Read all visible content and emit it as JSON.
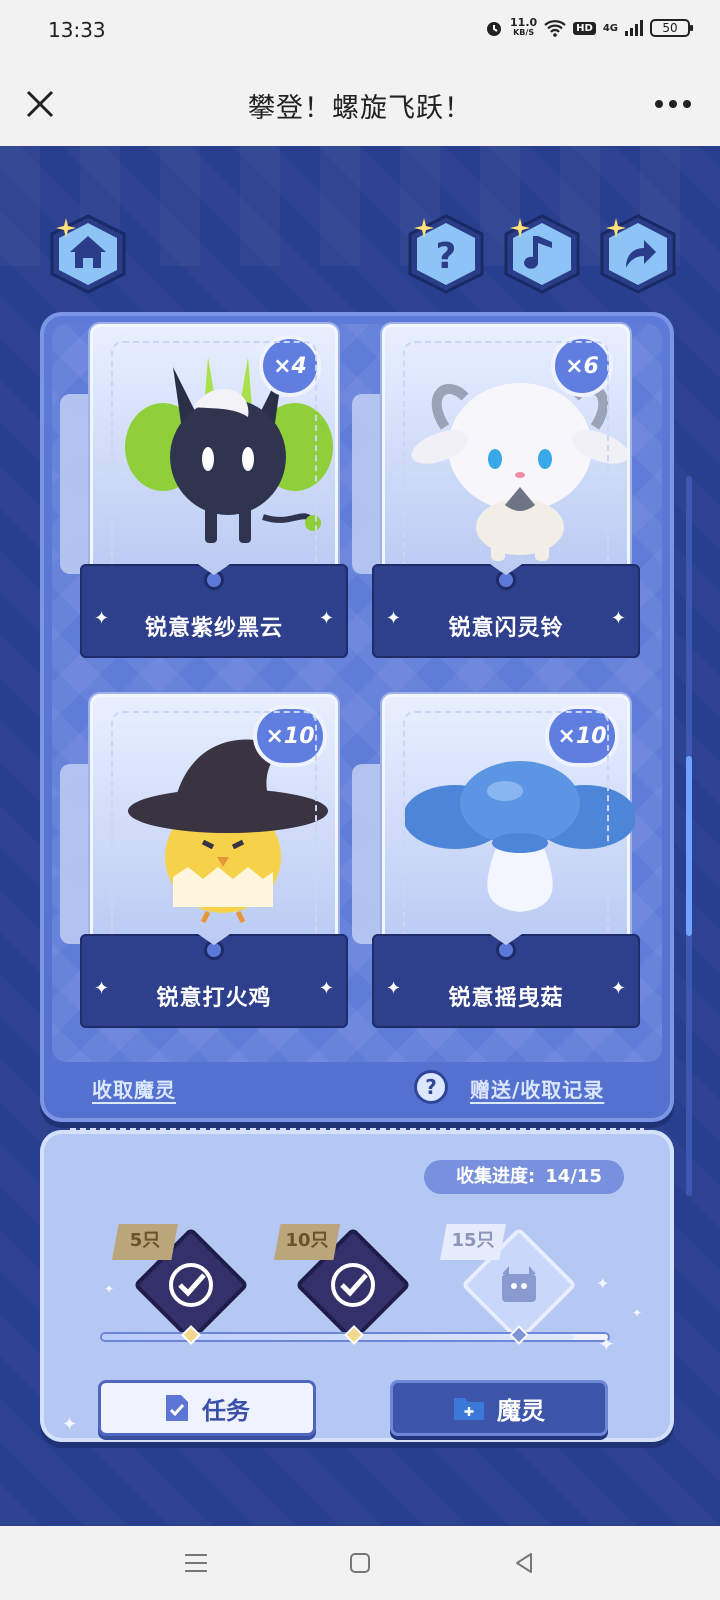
{
  "status_bar": {
    "time": "13:33",
    "net_speed_value": "11.0",
    "net_speed_unit": "KB/S",
    "hd_label": "HD",
    "network": "4G",
    "battery": "50"
  },
  "titlebar": {
    "title": "攀登！螺旋飞跃！"
  },
  "cards": [
    {
      "name": "锐意紫纱黑云",
      "count": "×4"
    },
    {
      "name": "锐意闪灵铃",
      "count": "×6"
    },
    {
      "name": "锐意打火鸡",
      "count": "×10"
    },
    {
      "name": "锐意摇曳菇",
      "count": "×10"
    }
  ],
  "links": {
    "collect": "收取魔灵",
    "history": "赠送/收取记录",
    "help_symbol": "?"
  },
  "progress": {
    "label": "收集进度:",
    "value": "14/15",
    "fraction": 0.9333,
    "milestones": [
      {
        "label": "5只",
        "done": true
      },
      {
        "label": "10只",
        "done": true
      },
      {
        "label": "15只",
        "done": false
      }
    ]
  },
  "buttons": {
    "task": "任务",
    "spirit": "魔灵"
  },
  "colors": {
    "game_bg": "#283e8e",
    "panel": "#5d7ad8",
    "plate": "#2e3f8c",
    "progress_panel": "#b5c8f3"
  }
}
